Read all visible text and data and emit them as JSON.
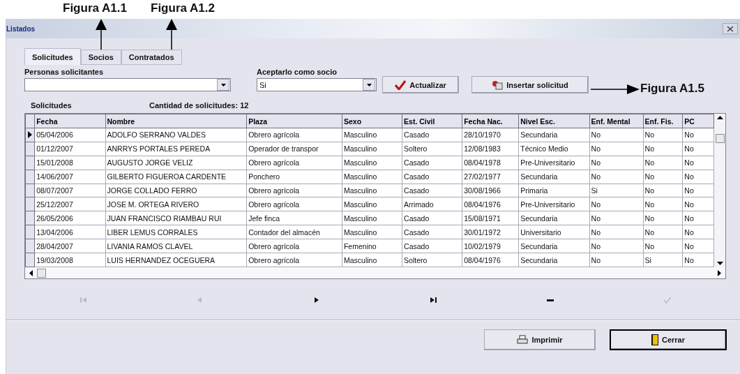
{
  "annotations": [
    {
      "label": "Figura A1.1",
      "kind": "up"
    },
    {
      "label": "Figura A1.2",
      "kind": "up"
    },
    {
      "label": "Figura A1.5",
      "kind": "right"
    }
  ],
  "window": {
    "title": "Listados"
  },
  "tabs": [
    {
      "label": "Solicitudes",
      "selected": true
    },
    {
      "label": "Socios",
      "selected": false
    },
    {
      "label": "Contratados",
      "selected": false
    }
  ],
  "filters": [
    {
      "label": "Personas solicitantes"
    },
    {
      "label": "Aceptarlo como socio",
      "value": "Si"
    }
  ],
  "buttons": [
    {
      "label": "Actualizar",
      "kind": "check"
    },
    {
      "label": "Insertar solicitud",
      "kind": "insert"
    }
  ],
  "grid_title": "Solicitudes",
  "count": "Cantidad de solicitudes: 12",
  "table": {
    "columns": [
      "Fecha",
      "Nombre",
      "Plaza",
      "Sexo",
      "Est. Civil",
      "Fecha Nac.",
      "Nivel Esc.",
      "Enf. Mental",
      "Enf. Fis.",
      "PC"
    ],
    "rows": [
      {
        "selected": true,
        "cells": [
          "05/04/2006",
          "ADOLFO SERRANO VALDES",
          "Obrero agrícola",
          "Masculino",
          "Casado",
          "28/10/1970",
          "Secundaria",
          "No",
          "No",
          "No"
        ]
      },
      {
        "selected": false,
        "cells": [
          "01/12/2007",
          "ANRRYS PORTALES PEREDA",
          "Operador de transpor",
          "Masculino",
          "Soltero",
          "12/08/1983",
          "Técnico Medio",
          "No",
          "No",
          "No"
        ]
      },
      {
        "selected": false,
        "cells": [
          "15/01/2008",
          "AUGUSTO JORGE VELIZ",
          "Obrero agrícola",
          "Masculino",
          "Casado",
          "08/04/1978",
          "Pre-Universitario",
          "No",
          "No",
          "No"
        ]
      },
      {
        "selected": false,
        "cells": [
          "14/06/2007",
          "GILBERTO FIGUEROA CARDENTE",
          "Ponchero",
          "Masculino",
          "Casado",
          "27/02/1977",
          "Secundaria",
          "No",
          "No",
          "No"
        ]
      },
      {
        "selected": false,
        "cells": [
          "08/07/2007",
          "JORGE COLLADO FERRO",
          "Obrero agrícola",
          "Masculino",
          "Casado",
          "30/08/1966",
          "Primaria",
          "Si",
          "No",
          "No"
        ]
      },
      {
        "selected": false,
        "cells": [
          "25/12/2007",
          "JOSE M. ORTEGA RIVERO",
          "Obrero agrícola",
          "Masculino",
          "Arrimado",
          "08/04/1976",
          "Pre-Universitario",
          "No",
          "No",
          "No"
        ]
      },
      {
        "selected": false,
        "cells": [
          "26/05/2006",
          "JUAN FRANCISCO RIAMBAU RUI",
          "Jefe finca",
          "Masculino",
          "Casado",
          "15/08/1971",
          "Secundaria",
          "No",
          "No",
          "No"
        ]
      },
      {
        "selected": false,
        "cells": [
          "13/04/2006",
          "LIBER LEMUS CORRALES",
          "Contador del almacén",
          "Masculino",
          "Casado",
          "30/01/1972",
          "Universitario",
          "No",
          "No",
          "No"
        ]
      },
      {
        "selected": false,
        "cells": [
          "28/04/2007",
          "LIVANIA RAMOS CLAVEL",
          "Obrero agrícola",
          "Femenino",
          "Casado",
          "10/02/1979",
          "Secundaria",
          "No",
          "No",
          "No"
        ]
      },
      {
        "selected": false,
        "cells": [
          "19/03/2008",
          "LUIS HERNANDEZ OCEGUERA",
          "Obrero agrícola",
          "Masculino",
          "Soltero",
          "08/04/1976",
          "Secundaria",
          "No",
          "Si",
          "No"
        ]
      }
    ]
  },
  "navigator": [
    {
      "kind": "first",
      "disabled": true
    },
    {
      "kind": "prior",
      "disabled": true
    },
    {
      "kind": "next",
      "disabled": false
    },
    {
      "kind": "last",
      "disabled": false
    },
    {
      "kind": "delete",
      "disabled": false
    },
    {
      "kind": "post",
      "disabled": true
    }
  ],
  "footer_buttons": [
    {
      "label": "Imprimir",
      "kind": "print",
      "focused": false
    },
    {
      "label": "Cerrar",
      "kind": "close",
      "focused": true
    }
  ]
}
